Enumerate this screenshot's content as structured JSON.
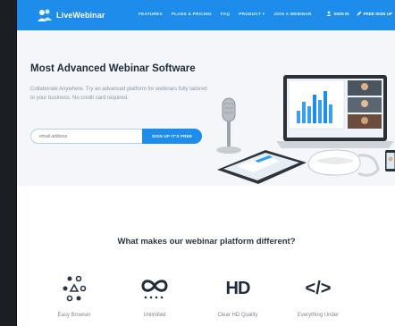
{
  "brand": {
    "name": "LiveWebinar",
    "color": "#1d8ceb"
  },
  "nav": {
    "menu": [
      "FEATURES",
      "PLANS & PRICING",
      "FAQ",
      "PRODUCT",
      "JOIN A WEBINAR"
    ],
    "product_caret": "▾",
    "sign_in": "SIGN IN",
    "free_signup": "FREE SIGN UP"
  },
  "hero": {
    "title": "Most Advanced Webinar Software",
    "description": "Collaborate Anywhere. Try an advanced platform for webinars fully tailored to your business. No credit card required.",
    "email_placeholder": "email address",
    "cta_label": "SIGN UP IT'S FREE"
  },
  "features": {
    "title": "What makes our webinar platform different?",
    "items": [
      {
        "icon": "browser-icon",
        "label": "Easy Browser"
      },
      {
        "icon": "infinity-icon",
        "label": "Unlimited"
      },
      {
        "icon": "hd-icon",
        "label": "Clear HD Quality"
      },
      {
        "icon": "code-icon",
        "label": "Everything Under"
      }
    ],
    "hd_text": "HD",
    "code_text": "</>"
  }
}
